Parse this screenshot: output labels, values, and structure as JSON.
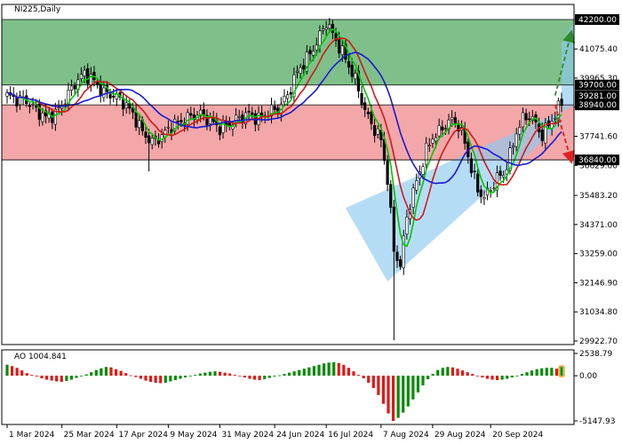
{
  "chart_data": {
    "type": "candlestick",
    "symbol": "NI225,Daily",
    "price_ylim": [
      29922.7,
      42200.0
    ],
    "price_axis_ticks": [
      "42200.00",
      "41075.40",
      "39965.30",
      "38852.50",
      "37741.60",
      "36629.00",
      "35483.20",
      "34371.00",
      "33259.00",
      "32146.90",
      "31034.80",
      "29922.70"
    ],
    "highlighted_levels": [
      {
        "label": "42200.00",
        "value": 42200.0,
        "color": "#000000"
      },
      {
        "label": "39700.00",
        "value": 39700.0,
        "color": "#000000"
      },
      {
        "label": "39281.00",
        "value": 39281.0,
        "color": "#000000"
      },
      {
        "label": "38940.00",
        "value": 38940.0,
        "color": "#000000"
      },
      {
        "label": "36840.00",
        "value": 36840.0,
        "color": "#000000"
      }
    ],
    "zones": [
      {
        "from": 39700.0,
        "to": 42200.0,
        "color": "#7fc08a"
      },
      {
        "from": 36840.0,
        "to": 38940.0,
        "color": "#f4a7a9"
      }
    ],
    "x_axis_labels": [
      "1 Mar 2024",
      "25 Mar 2024",
      "17 Apr 2024",
      "9 May 2024",
      "31 May 2024",
      "24 Jun 2024",
      "16 Jul 2024",
      "7 Aug 2024",
      "29 Aug 2024",
      "20 Sep 2024"
    ],
    "close_path": [
      [
        0,
        39300
      ],
      [
        3,
        39150
      ],
      [
        6,
        39100
      ],
      [
        9,
        38750
      ],
      [
        12,
        38450
      ],
      [
        15,
        38600
      ],
      [
        18,
        39150
      ],
      [
        21,
        39750
      ],
      [
        24,
        40150
      ],
      [
        27,
        39850
      ],
      [
        30,
        39400
      ],
      [
        33,
        39300
      ],
      [
        36,
        39050
      ],
      [
        39,
        38600
      ],
      [
        42,
        37900
      ],
      [
        45,
        37500
      ],
      [
        48,
        37750
      ],
      [
        51,
        38150
      ],
      [
        54,
        38300
      ],
      [
        57,
        38500
      ],
      [
        60,
        38600
      ],
      [
        63,
        38350
      ],
      [
        66,
        38050
      ],
      [
        69,
        38200
      ],
      [
        72,
        38450
      ],
      [
        75,
        38600
      ],
      [
        78,
        38400
      ],
      [
        81,
        38650
      ],
      [
        84,
        38800
      ],
      [
        87,
        39300
      ],
      [
        90,
        40200
      ],
      [
        93,
        40700
      ],
      [
        96,
        41300
      ],
      [
        99,
        42100
      ],
      [
        102,
        41400
      ],
      [
        105,
        40700
      ],
      [
        108,
        39900
      ],
      [
        111,
        38700
      ],
      [
        114,
        38000
      ],
      [
        116,
        37600
      ],
      [
        118,
        36100
      ],
      [
        120,
        33400
      ],
      [
        122,
        32800
      ],
      [
        124,
        34700
      ],
      [
        126,
        35600
      ],
      [
        128,
        36400
      ],
      [
        130,
        37200
      ],
      [
        132,
        37700
      ],
      [
        134,
        37900
      ],
      [
        136,
        38200
      ],
      [
        138,
        38350
      ],
      [
        140,
        38150
      ],
      [
        142,
        37500
      ],
      [
        144,
        36500
      ],
      [
        146,
        35700
      ],
      [
        148,
        35400
      ],
      [
        150,
        35750
      ],
      [
        152,
        36150
      ],
      [
        154,
        36300
      ],
      [
        156,
        37000
      ],
      [
        158,
        37900
      ],
      [
        160,
        38400
      ],
      [
        162,
        38550
      ],
      [
        164,
        38200
      ],
      [
        166,
        37750
      ],
      [
        168,
        38200
      ],
      [
        170,
        38550
      ],
      [
        172,
        39050
      ]
    ],
    "last_bar_index": 172,
    "moving_averages": [
      {
        "type": "SMA",
        "color": "#00c800",
        "period": 5
      },
      {
        "type": "SMA",
        "color": "#d01a1a",
        "period": 10
      },
      {
        "type": "SMA",
        "color": "#1a1ad0",
        "period": 20
      }
    ],
    "channel": {
      "color": "#8ec9f0",
      "points": [
        [
          105,
          35000
        ],
        [
          118,
          32200
        ],
        [
          172,
          38200
        ],
        [
          172,
          41300
        ]
      ]
    },
    "arrows": [
      {
        "from": [
          170,
          39300
        ],
        "to": [
          175,
          41700
        ],
        "color": "#2d8a2d"
      },
      {
        "from": [
          170,
          38950
        ],
        "to": [
          175,
          36800
        ],
        "color": "#e02020"
      }
    ],
    "oscillator": {
      "label": "AO 1004.841",
      "ylim": [
        -5147.93,
        2538.79
      ],
      "ticks": [
        "2538.79",
        "0.00",
        "-5147.93"
      ],
      "positive_color": "#0a8a0a",
      "negative_color": "#e01818",
      "values": [
        1250,
        1100,
        900,
        600,
        300,
        100,
        -100,
        -300,
        -450,
        -550,
        -650,
        -700,
        -600,
        -450,
        -250,
        -50,
        150,
        400,
        650,
        850,
        1000,
        950,
        750,
        550,
        300,
        50,
        -150,
        -350,
        -550,
        -700,
        -800,
        -850,
        -800,
        -650,
        -500,
        -350,
        -200,
        -50,
        100,
        250,
        350,
        450,
        500,
        450,
        350,
        250,
        100,
        -50,
        -200,
        -350,
        -450,
        -500,
        -400,
        -250,
        -100,
        50,
        200,
        350,
        500,
        650,
        800,
        950,
        1100,
        1250,
        1400,
        1500,
        1550,
        1450,
        1250,
        900,
        500,
        100,
        -300,
        -800,
        -1400,
        -2200,
        -3200,
        -4300,
        -5147,
        -4800,
        -4200,
        -3500,
        -2700,
        -1900,
        -1100,
        -400,
        200,
        650,
        900,
        1000,
        950,
        800,
        600,
        400,
        200,
        0,
        -200,
        -350,
        -450,
        -500,
        -450,
        -350,
        -200,
        0,
        200,
        400,
        600,
        750,
        850,
        900,
        900,
        800,
        1004
      ]
    }
  }
}
